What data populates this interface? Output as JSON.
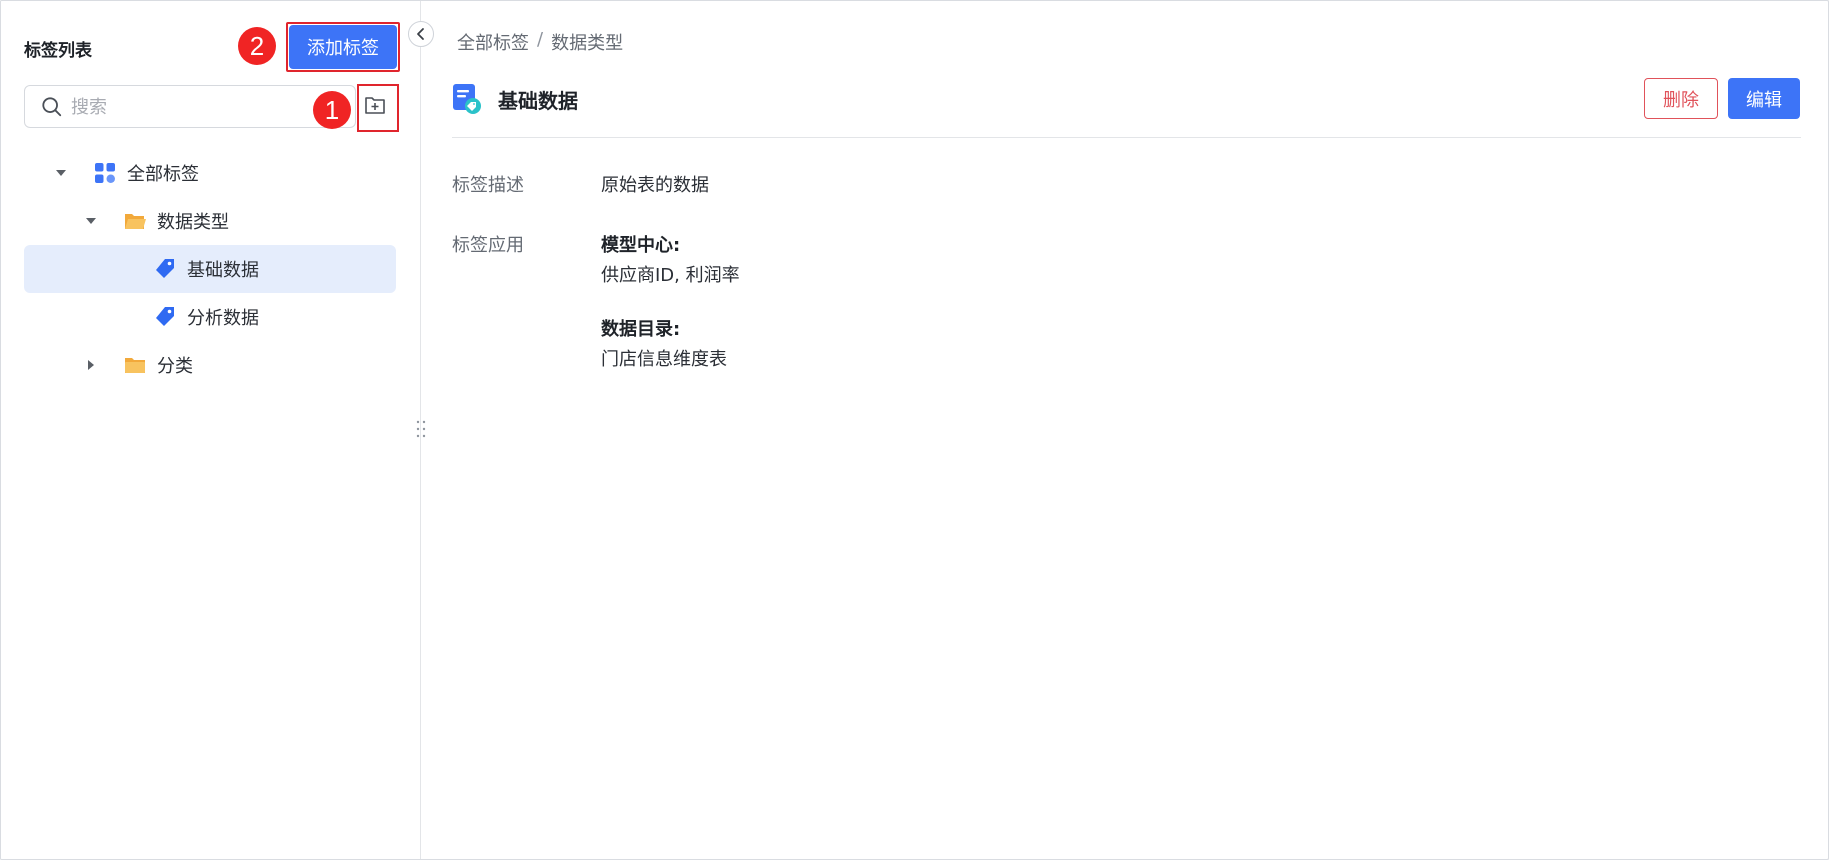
{
  "sidebar": {
    "title": "标签列表",
    "add_tag_label": "添加标签",
    "search_placeholder": "搜索",
    "step_badges": [
      "1",
      "2"
    ],
    "tree": {
      "all_tags": "全部标签",
      "data_type": "数据类型",
      "basic_data": "基础数据",
      "analysis_data": "分析数据",
      "category": "分类"
    }
  },
  "breadcrumb": {
    "items": [
      "全部标签",
      "数据类型"
    ],
    "separator": "/"
  },
  "detail": {
    "title": "基础数据",
    "delete_label": "删除",
    "edit_label": "编辑",
    "description_label": "标签描述",
    "description_value": "原始表的数据",
    "application_label": "标签应用",
    "applications": [
      {
        "heading": "模型中心:",
        "items": "供应商ID, 利润率"
      },
      {
        "heading": "数据目录:",
        "items": "门店信息维度表"
      }
    ]
  },
  "colors": {
    "primary": "#3d74f7",
    "danger": "#e0525a",
    "highlight_box": "#e0252d",
    "badge": "#f02424",
    "folder": "#f7b84a",
    "selected_row": "#e5edfc"
  }
}
